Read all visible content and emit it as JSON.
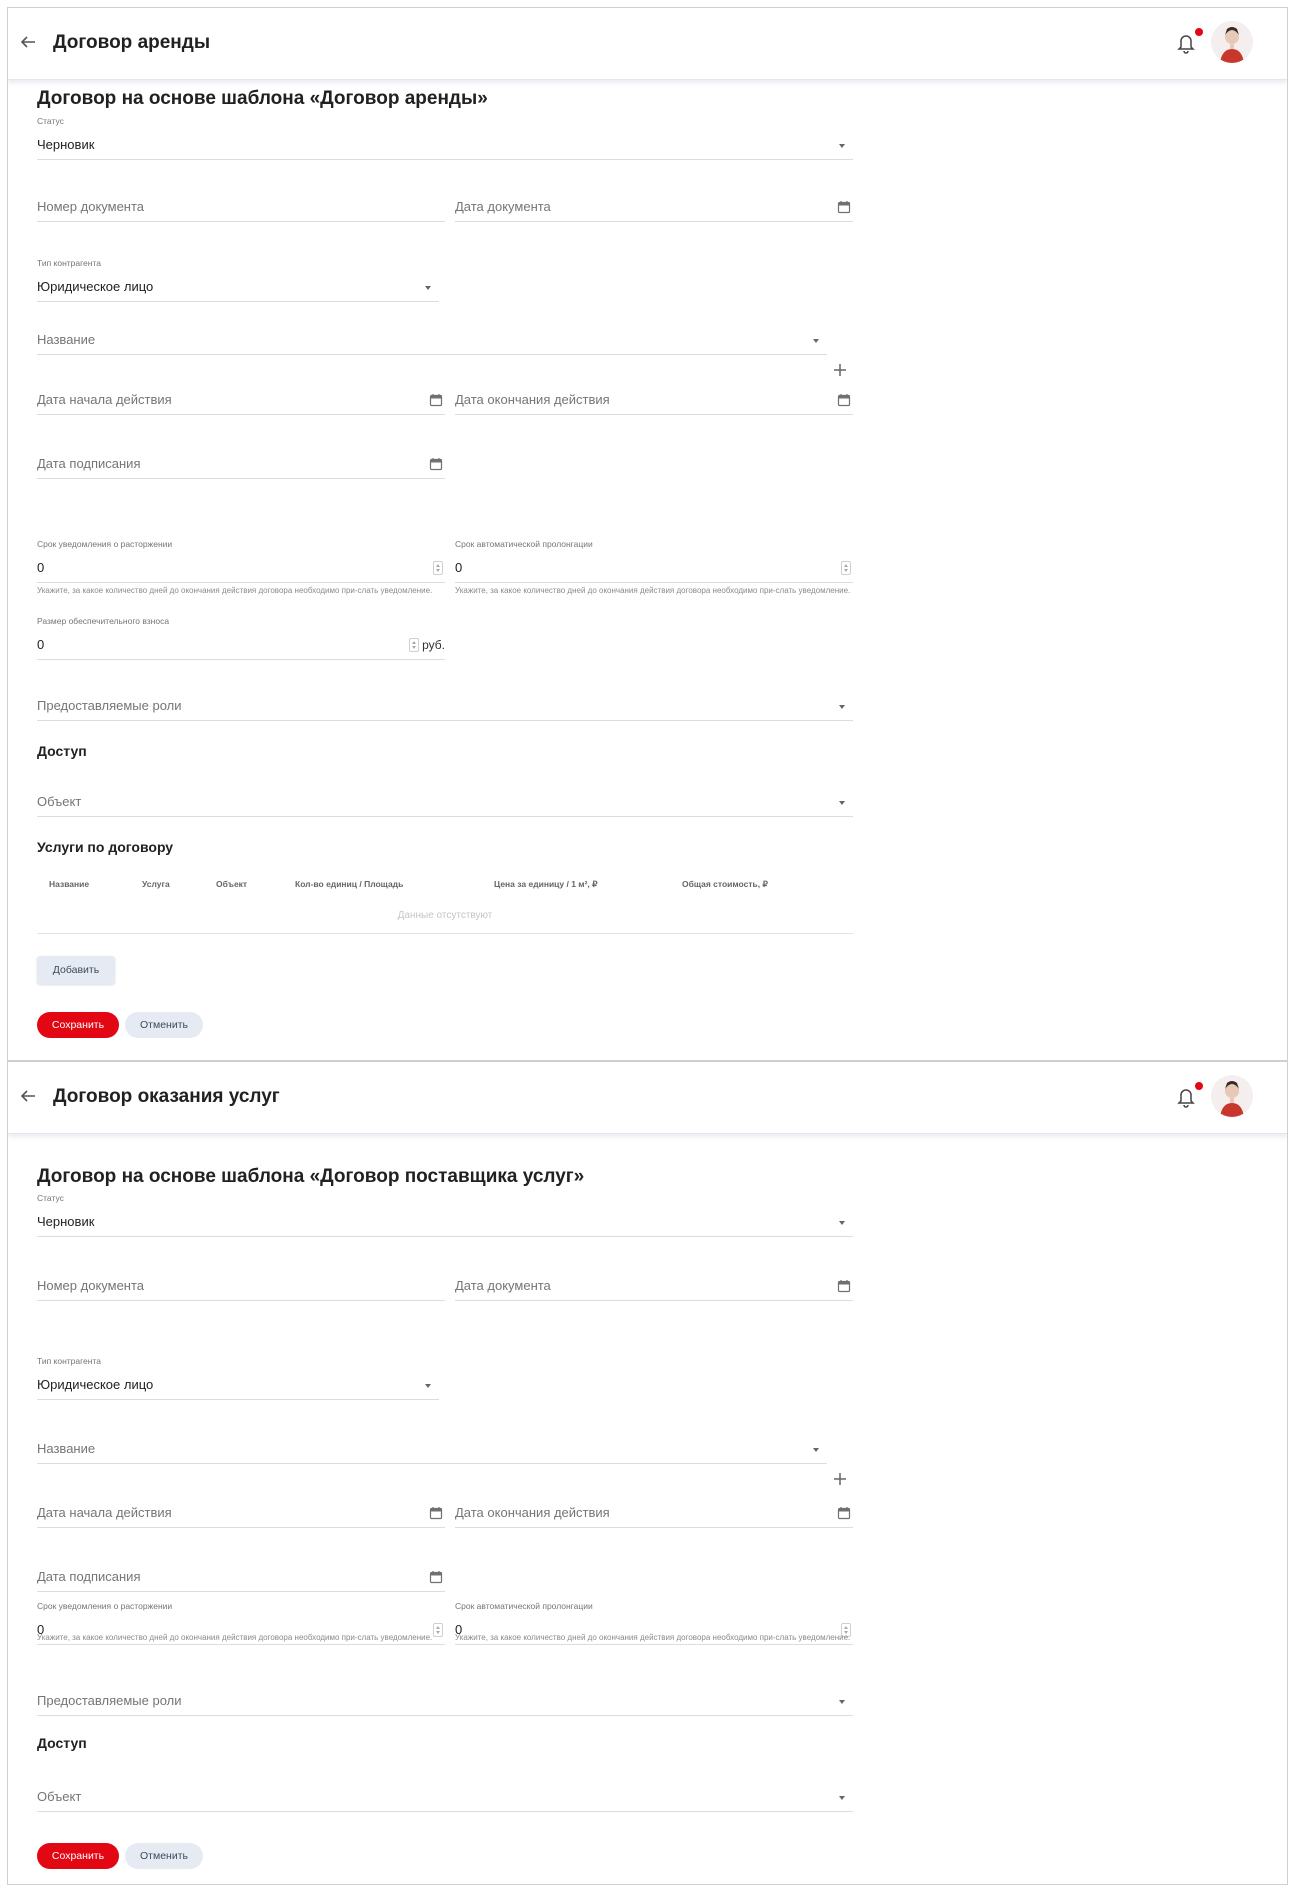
{
  "panels": [
    {
      "header": {
        "title": "Договор аренды"
      },
      "page_title": "Договор на основе шаблона «Договор аренды»",
      "status": {
        "label": "Статус",
        "value": "Черновик"
      },
      "doc_number": {
        "placeholder": "Номер документа"
      },
      "doc_date": {
        "placeholder": "Дата документа"
      },
      "counterparty_type": {
        "label": "Тип контрагента",
        "value": "Юридическое лицо"
      },
      "name": {
        "placeholder": "Название"
      },
      "start_date": {
        "placeholder": "Дата начала действия"
      },
      "end_date": {
        "placeholder": "Дата окончания действия"
      },
      "sign_date": {
        "placeholder": "Дата подписания"
      },
      "termination_notice": {
        "label": "Срок уведомления о расторжении",
        "value": "0",
        "hint": "Укажите, за какое количество дней до окончания действия договора необходимо при-слать уведомление."
      },
      "auto_prolongation": {
        "label": "Срок автоматической пролонгации",
        "value": "0",
        "hint": "Укажите, за какое количество дней до окончания действия договора необходимо при-слать уведомление."
      },
      "deposit": {
        "label": "Размер обеспечительного взноса",
        "value": "0",
        "suffix": "руб."
      },
      "roles": {
        "placeholder": "Предоставляемые роли"
      },
      "access_title": "Доступ",
      "object": {
        "placeholder": "Объект"
      },
      "services": {
        "title": "Услуги по договору",
        "columns": [
          "Название",
          "Услуга",
          "Объект",
          "Кол-во единиц / Площадь",
          "Цена за единицу / 1 м², ₽",
          "Общая стоимость, ₽"
        ],
        "empty": "Данные отсутствуют",
        "add_label": "Добавить"
      },
      "save_label": "Сохранить",
      "cancel_label": "Отменить"
    },
    {
      "header": {
        "title": "Договор оказания услуг"
      },
      "page_title": "Договор на основе шаблона «Договор поставщика услуг»",
      "status": {
        "label": "Статус",
        "value": "Черновик"
      },
      "doc_number": {
        "placeholder": "Номер документа"
      },
      "doc_date": {
        "placeholder": "Дата документа"
      },
      "counterparty_type": {
        "label": "Тип контрагента",
        "value": "Юридическое лицо"
      },
      "name": {
        "placeholder": "Название"
      },
      "start_date": {
        "placeholder": "Дата начала действия"
      },
      "end_date": {
        "placeholder": "Дата окончания действия"
      },
      "sign_date": {
        "placeholder": "Дата подписания"
      },
      "termination_notice": {
        "label": "Срок уведомления о расторжении",
        "value": "0",
        "hint": "Укажите, за какое количество дней до окончания действия договора необходимо при-слать уведомление."
      },
      "auto_prolongation": {
        "label": "Срок автоматической пролонгации",
        "value": "0",
        "hint": "Укажите, за какое количество дней до окончания действия договора необходимо при-слать уведомление."
      },
      "roles": {
        "placeholder": "Предоставляемые роли"
      },
      "access_title": "Доступ",
      "object": {
        "placeholder": "Объект"
      },
      "save_label": "Сохранить",
      "cancel_label": "Отменить"
    }
  ],
  "colors": {
    "accent": "#e30613",
    "notification_dot": "#e30613",
    "secondary_button": "#e6ebf3"
  },
  "icons": [
    "back-arrow-icon",
    "bell-icon",
    "calendar-icon",
    "chevron-down-icon",
    "plus-icon",
    "stepper-icon"
  ]
}
